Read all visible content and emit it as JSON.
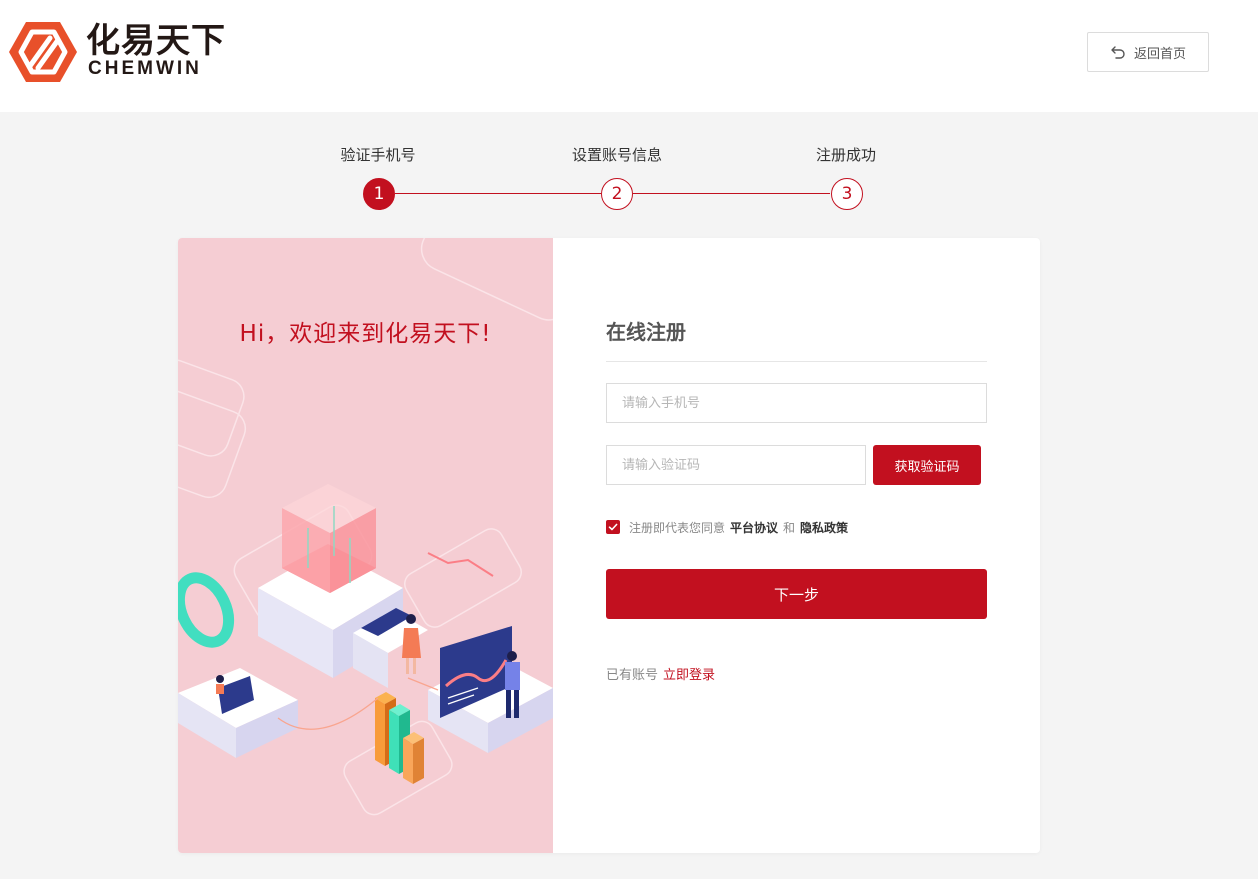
{
  "header": {
    "logo": {
      "name_cn": "化易天下",
      "name_en": "CHEMWIN"
    },
    "back_label": "返回首页"
  },
  "steps": [
    {
      "number": "1",
      "label": "验证手机号",
      "active": true
    },
    {
      "number": "2",
      "label": "设置账号信息",
      "active": false
    },
    {
      "number": "3",
      "label": "注册成功",
      "active": false
    }
  ],
  "welcome": "Hi，欢迎来到化易天下!",
  "form": {
    "title": "在线注册",
    "phone_placeholder": "请输入手机号",
    "code_placeholder": "请输入验证码",
    "get_code_label": "获取验证码",
    "agree_text": "注册即代表您同意",
    "agree_checked": true,
    "platform_agreement": "平台协议",
    "and_text": "和",
    "privacy_policy": "隐私政策",
    "next_label": "下一步",
    "has_account": "已有账号",
    "login_link": "立即登录"
  },
  "colors": {
    "brand": "#c2101f",
    "logo_orange": "#e8502a",
    "panel_pink": "#f5cdd3",
    "page_bg": "#f4f4f4"
  }
}
